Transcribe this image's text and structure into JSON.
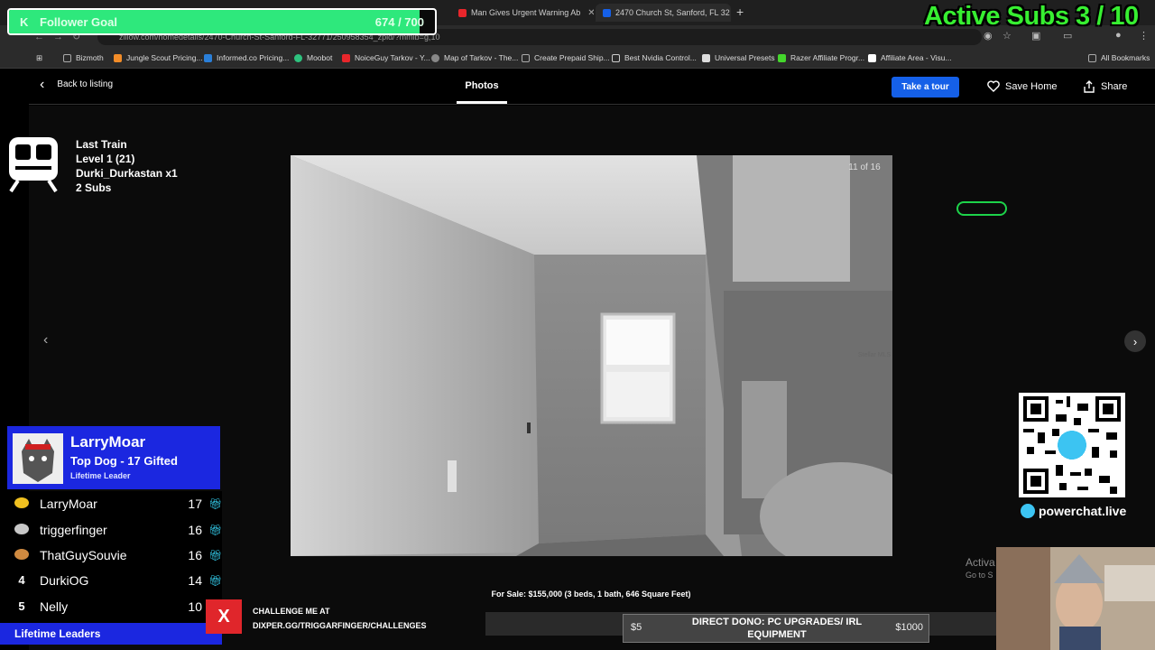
{
  "browser": {
    "tabs": [
      {
        "title": "Man Gives Urgent Warning Ab",
        "color": "#e8262b"
      },
      {
        "title": "2470 Church St, Sanford, FL 32",
        "color": "#1560e8"
      }
    ],
    "address": "zillow.com/homedetails/2470-Church-St-Sanford-FL-32771/250958354_zpid/?mmlb=g,10",
    "bookmarks": [
      "Bizmoth",
      "Jungle Scout Pricing...",
      "Informed.co Pricing...",
      "Moobot",
      "NoiceGuy Tarkov - Y...",
      "Map of Tarkov - The...",
      "Create Prepaid Ship...",
      "Best Nvidia Control...",
      "Universal Presets",
      "Razer Affiliate Progr...",
      "Affiliate Area - Visu...",
      "All Bookmarks"
    ]
  },
  "zillow": {
    "back_label": "Back to listing",
    "photos_tab": "Photos",
    "tour_button": "Take a tour",
    "save_home": "Save Home",
    "share": "Share",
    "counter": "11 of 16",
    "watermark": "Stellar MLS",
    "caption": "For Sale: $155,000 (3 beds, 1 bath, 646 Square Feet)"
  },
  "overlay": {
    "follower_goal": {
      "label": "Follower Goal",
      "count": "674 / 700",
      "progress": 0.963
    },
    "active_subs": "Active Subs 3 / 10",
    "last_train": {
      "title": "Last Train",
      "level": "Level 1 (21)",
      "user": "Durki_Durkastan x1",
      "subs": "2 Subs"
    },
    "top_leader": {
      "name": "LarryMoar",
      "subtitle": "Top Dog - 17 Gifted",
      "note": "Lifetime Leader"
    },
    "leaders": [
      {
        "rank": "",
        "name": "LarryMoar",
        "count": "17",
        "medal": "#f0c020"
      },
      {
        "rank": "",
        "name": "triggerfinger",
        "count": "16",
        "medal": "#c8c8c8"
      },
      {
        "rank": "",
        "name": "ThatGuySouvie",
        "count": "16",
        "medal": "#d08a40"
      },
      {
        "rank": "4",
        "name": "DurkiOG",
        "count": "14",
        "medal": ""
      },
      {
        "rank": "5",
        "name": "Nelly",
        "count": "10",
        "medal": ""
      }
    ],
    "lifetime_bar": "Lifetime Leaders",
    "challenge": {
      "logo": "X",
      "line1": "CHALLENGE ME AT",
      "line2": "DIXPER.GG/TRIGGARFINGER/CHALLENGES"
    },
    "dono": {
      "min": "$5",
      "max": "$1000",
      "title": "DIRECT DONO: PC UPGRADES/ IRL EQUIPMENT"
    },
    "powerchat": "powerchat.live",
    "activate_line1": "Activa",
    "activate_line2": "Go to S"
  }
}
